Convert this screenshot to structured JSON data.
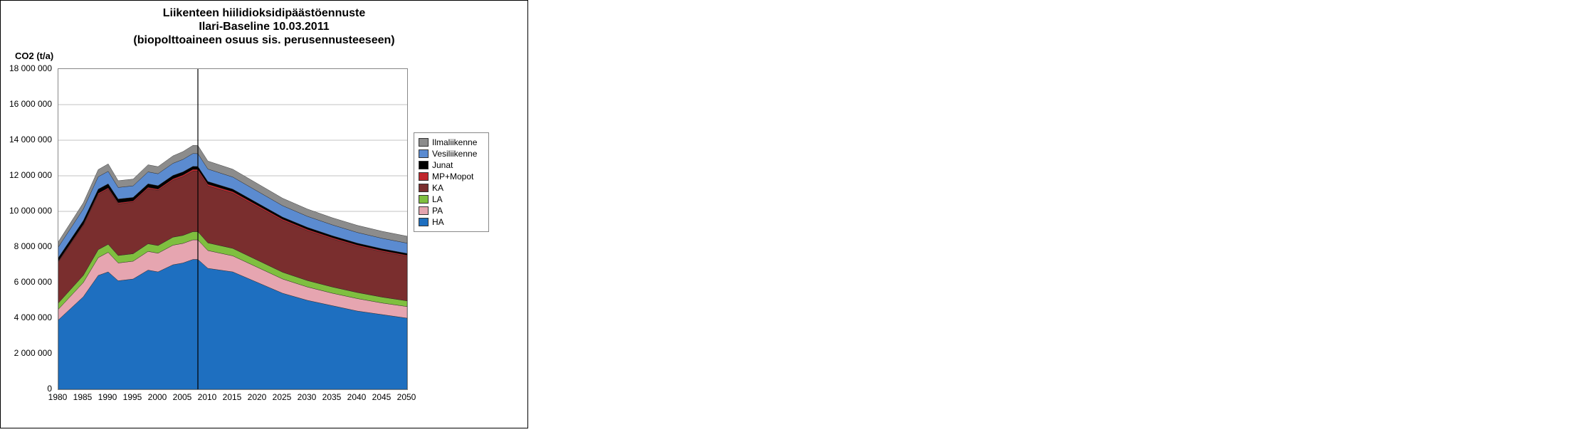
{
  "title_line1": "Liikenteen hiilidioksidipäästöennuste",
  "title_line2": "Ilari-Baseline 10.03.2011",
  "title_line3": "(biopolttoaineen osuus sis. perusennusteeseen)",
  "ylabel": "CO2 (t/a)",
  "yticks": [
    "0",
    "2 000 000",
    "4 000 000",
    "6 000 000",
    "8 000 000",
    "10 000 000",
    "12 000 000",
    "14 000 000",
    "16 000 000",
    "18 000 000"
  ],
  "xticks": [
    "1980",
    "1985",
    "1990",
    "1995",
    "2000",
    "2005",
    "2010",
    "2015",
    "2020",
    "2025",
    "2030",
    "2035",
    "2040",
    "2045",
    "2050"
  ],
  "legend": [
    {
      "key": "Ilmaliikenne",
      "color": "#8c8c8c"
    },
    {
      "key": "Vesiliikenne",
      "color": "#5b8bd0"
    },
    {
      "key": "Junat",
      "color": "#000000"
    },
    {
      "key": "MP+Mopot",
      "color": "#c0272d"
    },
    {
      "key": "KA",
      "color": "#7a2e2e"
    },
    {
      "key": "LA",
      "color": "#7fbf3f"
    },
    {
      "key": "PA",
      "color": "#e6a5b0"
    },
    {
      "key": "HA",
      "color": "#1e6fc0"
    }
  ],
  "chart_data": {
    "type": "area",
    "title": "Liikenteen hiilidioksidipäästöennuste — Ilari-Baseline 10.03.2011 (biopolttoaineen osuus sis. perusennusteeseen)",
    "xlabel": "",
    "ylabel": "CO2 (t/a)",
    "xlim": [
      1980,
      2050
    ],
    "ylim": [
      0,
      18000000
    ],
    "vline_at": 2008,
    "x": [
      1980,
      1985,
      1988,
      1990,
      1992,
      1995,
      1998,
      2000,
      2003,
      2005,
      2007,
      2008,
      2010,
      2015,
      2020,
      2025,
      2030,
      2035,
      2040,
      2045,
      2050
    ],
    "series": [
      {
        "name": "HA",
        "color": "#1e6fc0",
        "values": [
          3900000,
          5200000,
          6400000,
          6600000,
          6100000,
          6200000,
          6700000,
          6600000,
          7000000,
          7100000,
          7300000,
          7300000,
          6800000,
          6600000,
          6000000,
          5400000,
          5000000,
          4700000,
          4400000,
          4200000,
          4000000
        ]
      },
      {
        "name": "PA",
        "color": "#e6a5b0",
        "values": [
          600000,
          800000,
          1000000,
          1100000,
          1000000,
          1000000,
          1050000,
          1050000,
          1100000,
          1100000,
          1100000,
          1100000,
          1000000,
          900000,
          850000,
          800000,
          750000,
          700000,
          700000,
          650000,
          650000
        ]
      },
      {
        "name": "LA",
        "color": "#7fbf3f",
        "values": [
          350000,
          400000,
          450000,
          450000,
          420000,
          420000,
          430000,
          430000,
          450000,
          450000,
          460000,
          460000,
          430000,
          420000,
          400000,
          380000,
          360000,
          350000,
          340000,
          330000,
          320000
        ]
      },
      {
        "name": "KA",
        "color": "#7a2e2e",
        "values": [
          2300000,
          2800000,
          3100000,
          3100000,
          2900000,
          2900000,
          3100000,
          3100000,
          3200000,
          3300000,
          3400000,
          3400000,
          3200000,
          3100000,
          3000000,
          2900000,
          2800000,
          2700000,
          2600000,
          2550000,
          2500000
        ]
      },
      {
        "name": "MP+Mopot",
        "color": "#c0272d",
        "values": [
          50000,
          60000,
          70000,
          70000,
          65000,
          65000,
          70000,
          70000,
          80000,
          90000,
          100000,
          100000,
          95000,
          90000,
          85000,
          80000,
          75000,
          70000,
          70000,
          65000,
          65000
        ]
      },
      {
        "name": "Junat",
        "color": "#000000",
        "values": [
          200000,
          220000,
          230000,
          230000,
          210000,
          200000,
          200000,
          195000,
          190000,
          180000,
          170000,
          165000,
          155000,
          140000,
          130000,
          120000,
          115000,
          110000,
          105000,
          100000,
          100000
        ]
      },
      {
        "name": "Vesiliikenne",
        "color": "#5b8bd0",
        "values": [
          600000,
          650000,
          700000,
          700000,
          650000,
          650000,
          670000,
          670000,
          680000,
          700000,
          720000,
          720000,
          700000,
          680000,
          660000,
          640000,
          620000,
          610000,
          600000,
          590000,
          580000
        ]
      },
      {
        "name": "Ilmaliikenne",
        "color": "#8c8c8c",
        "values": [
          300000,
          350000,
          400000,
          420000,
          380000,
          380000,
          400000,
          400000,
          420000,
          440000,
          460000,
          460000,
          450000,
          440000,
          430000,
          420000,
          410000,
          400000,
          400000,
          395000,
          390000
        ]
      }
    ]
  }
}
